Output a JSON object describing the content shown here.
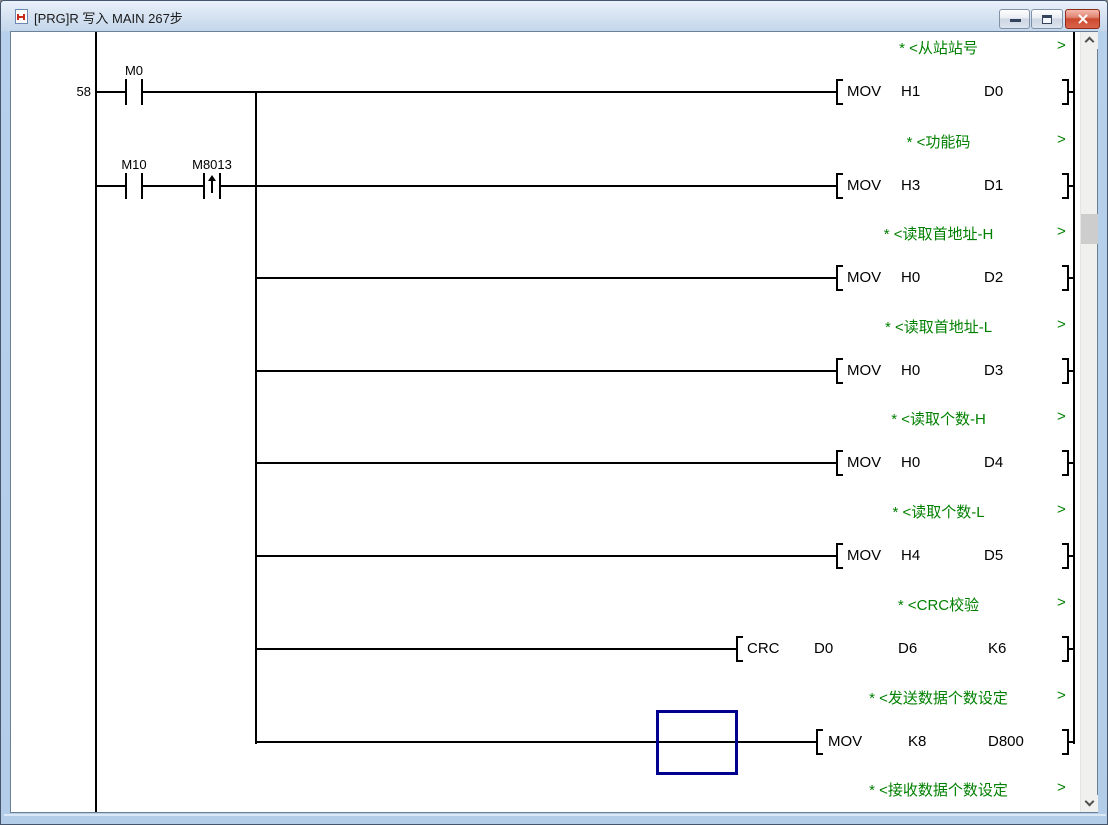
{
  "window": {
    "title": "[PRG]R 写入 MAIN 267步"
  },
  "ladder": {
    "step_number": "58",
    "comment_close": ">",
    "rungs": [
      {
        "comment": "* <从站站号",
        "op": "MOV",
        "arg1": "H1",
        "arg2": "D0",
        "contact1": "M0"
      },
      {
        "comment": "* <功能码",
        "op": "MOV",
        "arg1": "H3",
        "arg2": "D1",
        "contact1": "M10",
        "contact2": "M8013"
      },
      {
        "comment": "* <读取首地址-H",
        "op": "MOV",
        "arg1": "H0",
        "arg2": "D2"
      },
      {
        "comment": "* <读取首地址-L",
        "op": "MOV",
        "arg1": "H0",
        "arg2": "D3"
      },
      {
        "comment": "* <读取个数-H",
        "op": "MOV",
        "arg1": "H0",
        "arg2": "D4"
      },
      {
        "comment": "* <读取个数-L",
        "op": "MOV",
        "arg1": "H4",
        "arg2": "D5"
      },
      {
        "comment": "* <CRC校验",
        "op": "CRC",
        "arg1": "D0",
        "arg2": "D6",
        "arg3": "K6"
      },
      {
        "comment": "* <发送数据个数设定",
        "op": "MOV",
        "arg1": "K8",
        "arg2": "D800"
      }
    ],
    "trailing_comment": "* <接收数据个数设定"
  },
  "colors": {
    "comment_green": "#008000",
    "selection_blue": "#000090",
    "ladder_line": "#000000",
    "title_close_red": "#cc4a31"
  }
}
